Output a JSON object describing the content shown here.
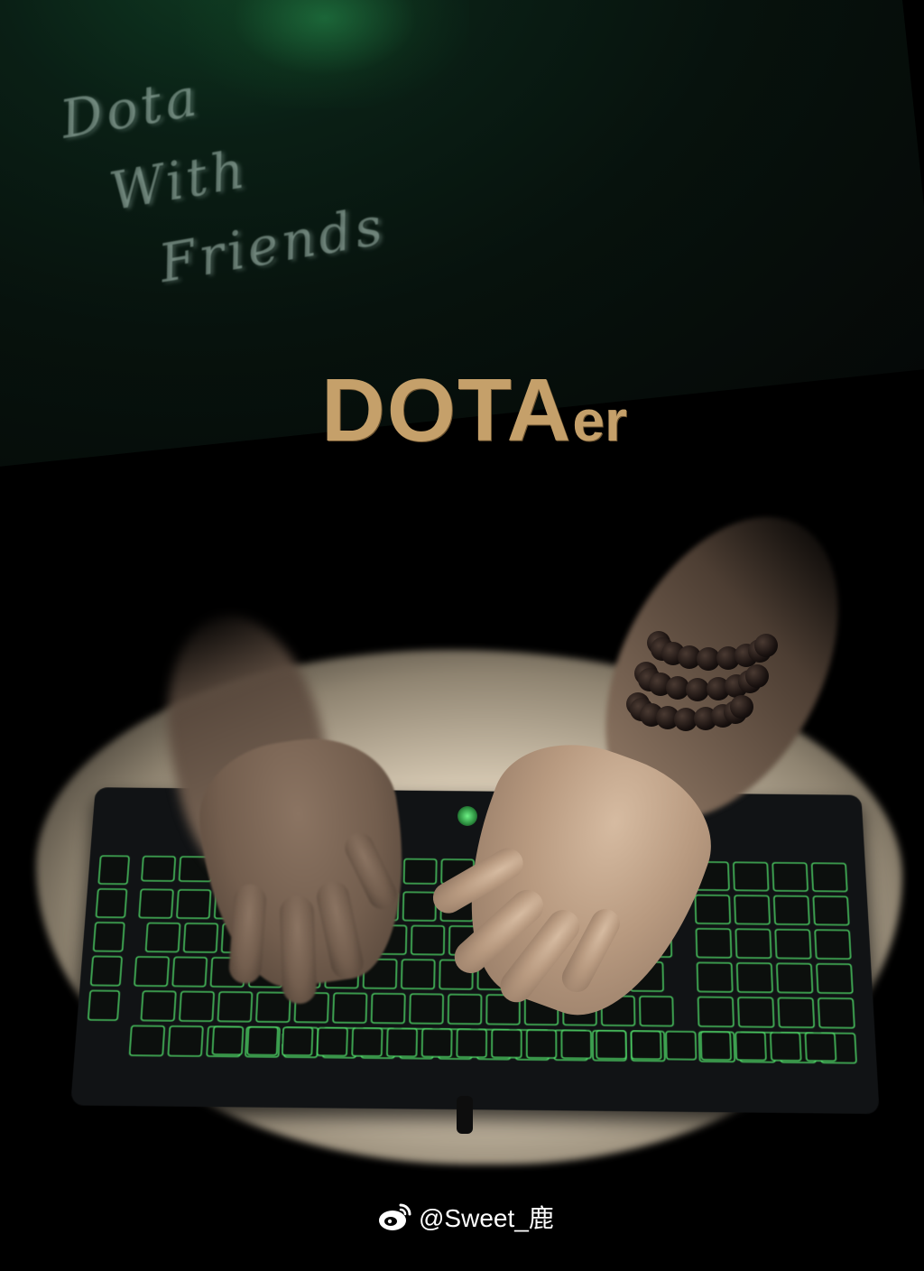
{
  "artwork": {
    "handwritten_lines": [
      "Dota",
      "With",
      "Friends"
    ],
    "title_main": "DOTA",
    "title_suffix": "er",
    "title_color": "#c5a06a",
    "keyboard_glow_color": "#5cff7a"
  },
  "watermark": {
    "icon": "weibo-icon",
    "text": "@Sweet_鹿"
  }
}
